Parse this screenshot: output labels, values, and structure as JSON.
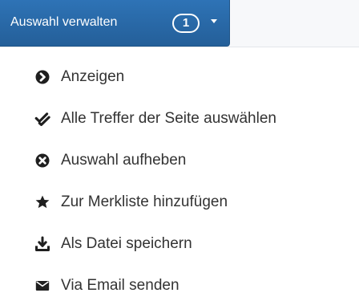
{
  "toolbar": {
    "selection_label": "Auswahl verwalten",
    "selection_count": "1"
  },
  "menu": {
    "items": [
      {
        "label": "Anzeigen",
        "icon": "arrow-circle-right-icon"
      },
      {
        "label": "Alle Treffer der Seite auswählen",
        "icon": "double-check-icon"
      },
      {
        "label": "Auswahl aufheben",
        "icon": "x-circle-icon"
      },
      {
        "label": "Zur Merkliste hinzufügen",
        "icon": "star-icon"
      },
      {
        "label": "Als Datei speichern",
        "icon": "download-icon"
      },
      {
        "label": "Via Email senden",
        "icon": "envelope-icon"
      }
    ]
  },
  "colors": {
    "button_blue": "#2e73b6",
    "text": "#333333"
  }
}
